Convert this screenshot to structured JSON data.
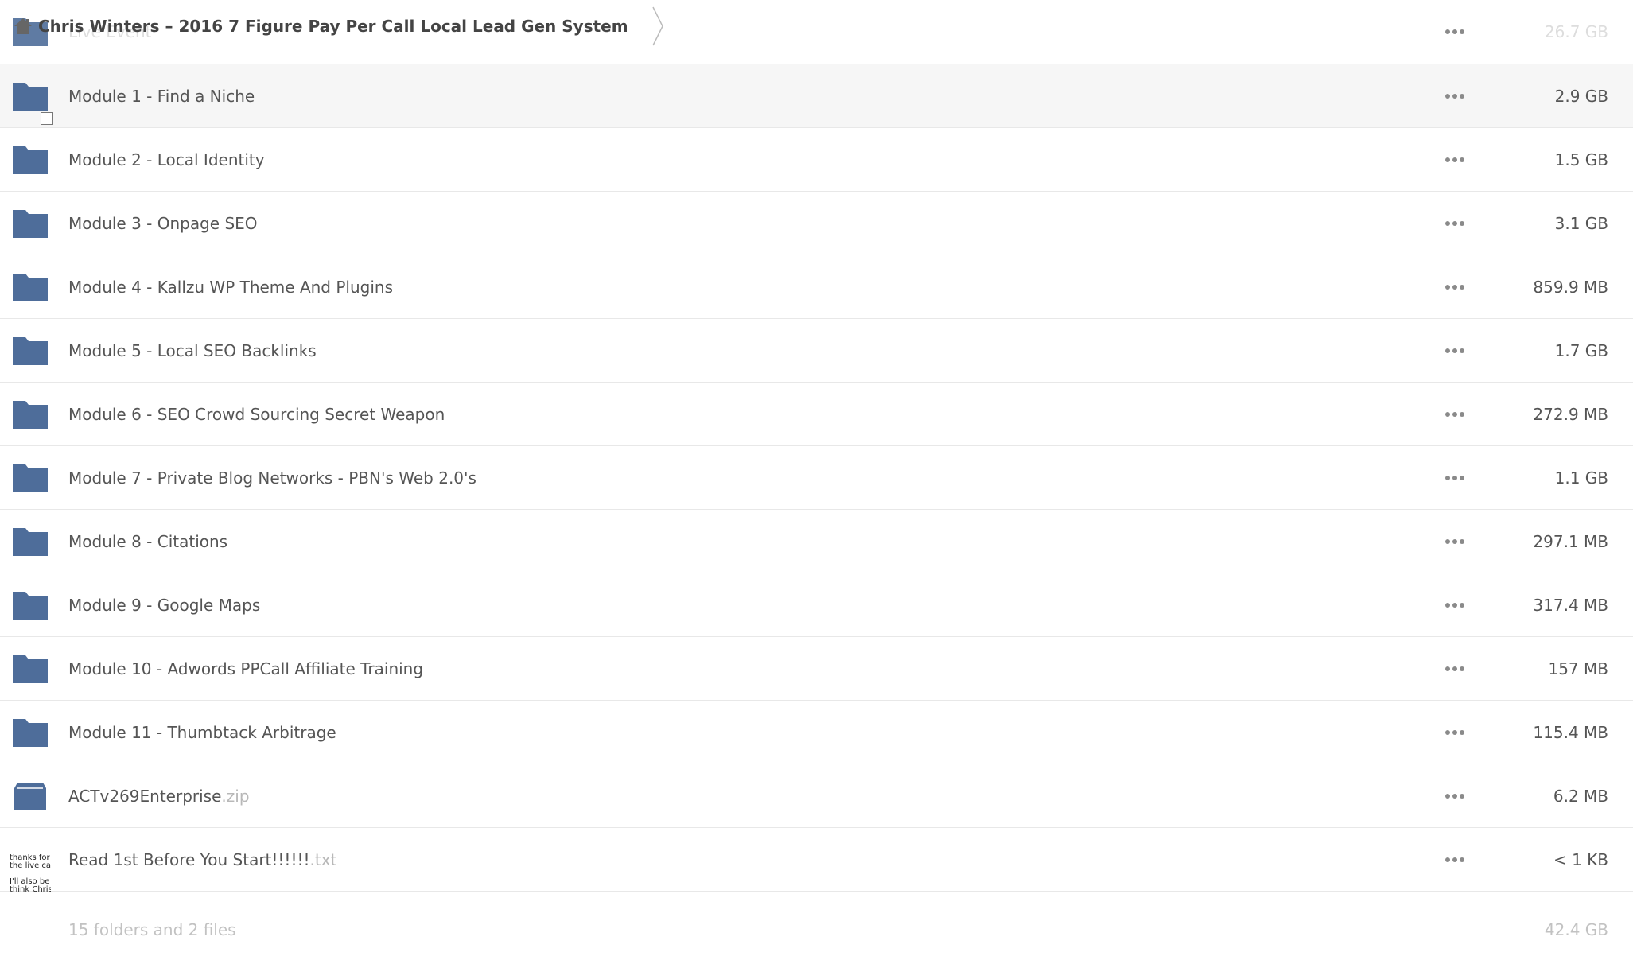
{
  "breadcrumb": {
    "title": "Chris Winters – 2016 7 Figure Pay Per Call Local Lead Gen System",
    "home_icon": "home-icon"
  },
  "colors": {
    "folder": "#4e6d9a",
    "archive": "#4e6d9a",
    "text": "#555555",
    "muted": "#c2c2c2",
    "row_hover": "#f6f6f6"
  },
  "items": [
    {
      "name": "Live Event",
      "ext": "",
      "size": "26.7 GB",
      "type": "folder"
    },
    {
      "name": "Module 1 - Find a Niche",
      "ext": "",
      "size": "2.9 GB",
      "type": "folder"
    },
    {
      "name": "Module 2 - Local Identity",
      "ext": "",
      "size": "1.5 GB",
      "type": "folder"
    },
    {
      "name": "Module 3 - Onpage SEO",
      "ext": "",
      "size": "3.1 GB",
      "type": "folder"
    },
    {
      "name": "Module 4 - Kallzu WP Theme And Plugins",
      "ext": "",
      "size": "859.9 MB",
      "type": "folder"
    },
    {
      "name": "Module 5 - Local SEO Backlinks",
      "ext": "",
      "size": "1.7 GB",
      "type": "folder"
    },
    {
      "name": "Module 6 - SEO Crowd Sourcing Secret Weapon",
      "ext": "",
      "size": "272.9 MB",
      "type": "folder"
    },
    {
      "name": "Module 7 - Private Blog Networks - PBN's Web 2.0's",
      "ext": "",
      "size": "1.1 GB",
      "type": "folder"
    },
    {
      "name": "Module 8 - Citations",
      "ext": "",
      "size": "297.1 MB",
      "type": "folder"
    },
    {
      "name": "Module 9 - Google Maps",
      "ext": "",
      "size": "317.4 MB",
      "type": "folder"
    },
    {
      "name": "Module 10 - Adwords PPCall Affiliate Training",
      "ext": "",
      "size": "157 MB",
      "type": "folder"
    },
    {
      "name": "Module 11 - Thumbtack Arbitrage",
      "ext": "",
      "size": "115.4 MB",
      "type": "folder"
    },
    {
      "name": "ACTv269Enterprise",
      "ext": ".zip",
      "size": "6.2 MB",
      "type": "archive"
    },
    {
      "name": "Read 1st Before You Start!!!!!!",
      "ext": ".txt",
      "size": "< 1 KB",
      "type": "text"
    }
  ],
  "txt_thumbnail": [
    "thanks for",
    "the live cal",
    "",
    "I'll also be",
    "think Chris"
  ],
  "footer": {
    "summary": "15 folders and 2 files",
    "total": "42.4 GB"
  }
}
